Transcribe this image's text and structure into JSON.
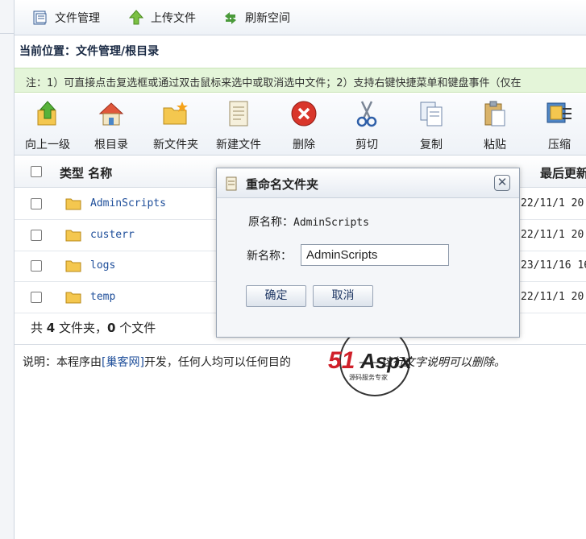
{
  "menu": {
    "file_manage": "文件管理",
    "upload": "上传文件",
    "refresh": "刷新空间"
  },
  "location": "当前位置：文件管理/根目录",
  "notice": "注：1）可直接点击复选框或通过双击鼠标来选中或取消选中文件；2）支持右键快捷菜单和键盘事件（仅在",
  "toolbar": {
    "up": "向上一级",
    "root": "根目录",
    "new_folder": "新文件夹",
    "new_file": "新建文件",
    "delete": "删除",
    "cut": "剪切",
    "copy": "复制",
    "paste": "粘贴",
    "compress": "压缩"
  },
  "table": {
    "header_type_name": "类型 名称",
    "header_modified": "最后更新",
    "rows": [
      {
        "name": "AdminScripts",
        "date": "22/11/1 20"
      },
      {
        "name": "custerr",
        "date": "22/11/1 20"
      },
      {
        "name": "logs",
        "date": "23/11/16 16"
      },
      {
        "name": "temp",
        "date": "22/11/1 20"
      }
    ]
  },
  "summary": {
    "prefix": "共",
    "folders": "4",
    "folders_unit": "文件夹，",
    "files": "0",
    "files_unit": "个文件"
  },
  "footer": {
    "prefix": "说明：本程序由",
    "link": "[巢客网]",
    "middle": "开发，任何人均可以任何目的",
    "suffix": "——这行文字说明可以删除。"
  },
  "dialog": {
    "title": "重命名文件夹",
    "original_label": "原名称：",
    "original_value": "AdminScripts",
    "new_label": "新名称：",
    "new_value": "AdminScripts",
    "ok": "确定",
    "cancel": "取消"
  },
  "watermark": {
    "brand": "51Aspx",
    "tagline": "源码服务专家"
  }
}
